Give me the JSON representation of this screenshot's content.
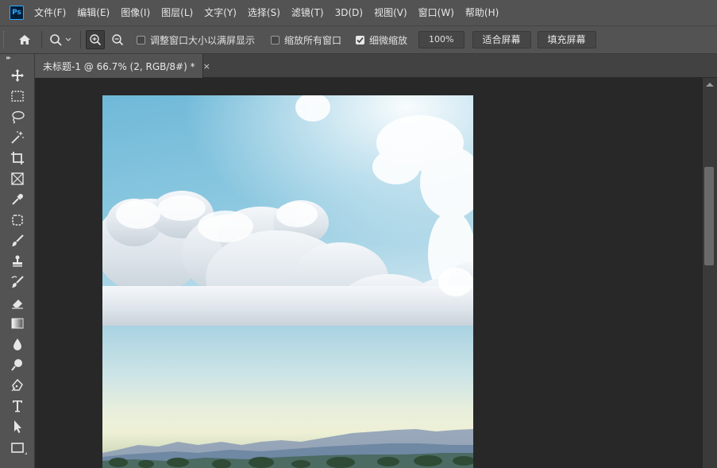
{
  "app": {
    "logo_text": "Ps"
  },
  "menu": [
    "文件(F)",
    "编辑(E)",
    "图像(I)",
    "图层(L)",
    "文字(Y)",
    "选择(S)",
    "滤镜(T)",
    "3D(D)",
    "视图(V)",
    "窗口(W)",
    "帮助(H)"
  ],
  "options": {
    "home_icon": "home-icon",
    "zoom_tool_icon": "zoom-icon",
    "resize_windows_label": "调整窗口大小以满屏显示",
    "resize_windows_checked": false,
    "zoom_all_label": "缩放所有窗口",
    "zoom_all_checked": false,
    "scrubby_zoom_label": "细微缩放",
    "scrubby_zoom_checked": true,
    "zoom_value": "100%",
    "fit_screen_label": "适合屏幕",
    "fill_screen_label": "填充屏幕"
  },
  "toolpanel": {
    "collapse_glyph": "▸▸",
    "tools": [
      "move-tool",
      "marquee-tool",
      "lasso-tool",
      "magic-wand-tool",
      "crop-tool",
      "frame-tool",
      "eyedropper-tool",
      "patch-tool",
      "brush-tool",
      "stamp-tool",
      "history-brush-tool",
      "eraser-tool",
      "gradient-tool",
      "blur-tool",
      "dodge-tool",
      "pen-tool",
      "type-tool",
      "path-select-tool",
      "rectangle-tool"
    ]
  },
  "document": {
    "tab_title": "未标题-1 @ 66.7% (2, RGB/8#) *",
    "close_glyph": "×"
  },
  "colors": {
    "chrome": "#535353",
    "workspace": "#282828",
    "accent": "#31a8ff"
  }
}
